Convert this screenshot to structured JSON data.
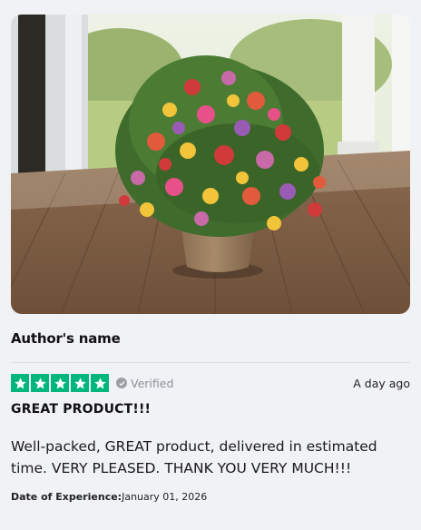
{
  "review": {
    "author": "Author's name",
    "rating": 5,
    "rating_max": 5,
    "verified_label": "Verified",
    "posted": "A day ago",
    "title": "GREAT PRODUCT!!!",
    "body": "Well-packed, GREAT product, delivered in estimated time. VERY PLEASED. THANK YOU VERY MUCH!!!",
    "experience_label": "Date of Experience:",
    "experience_date": "January 01, 2026"
  },
  "colors": {
    "star_green": "#00b67a",
    "verified_gray": "#9aa0a6",
    "background": "#f1f2f6"
  },
  "icons": {
    "star": "star-icon",
    "verified": "check-circle-icon"
  }
}
